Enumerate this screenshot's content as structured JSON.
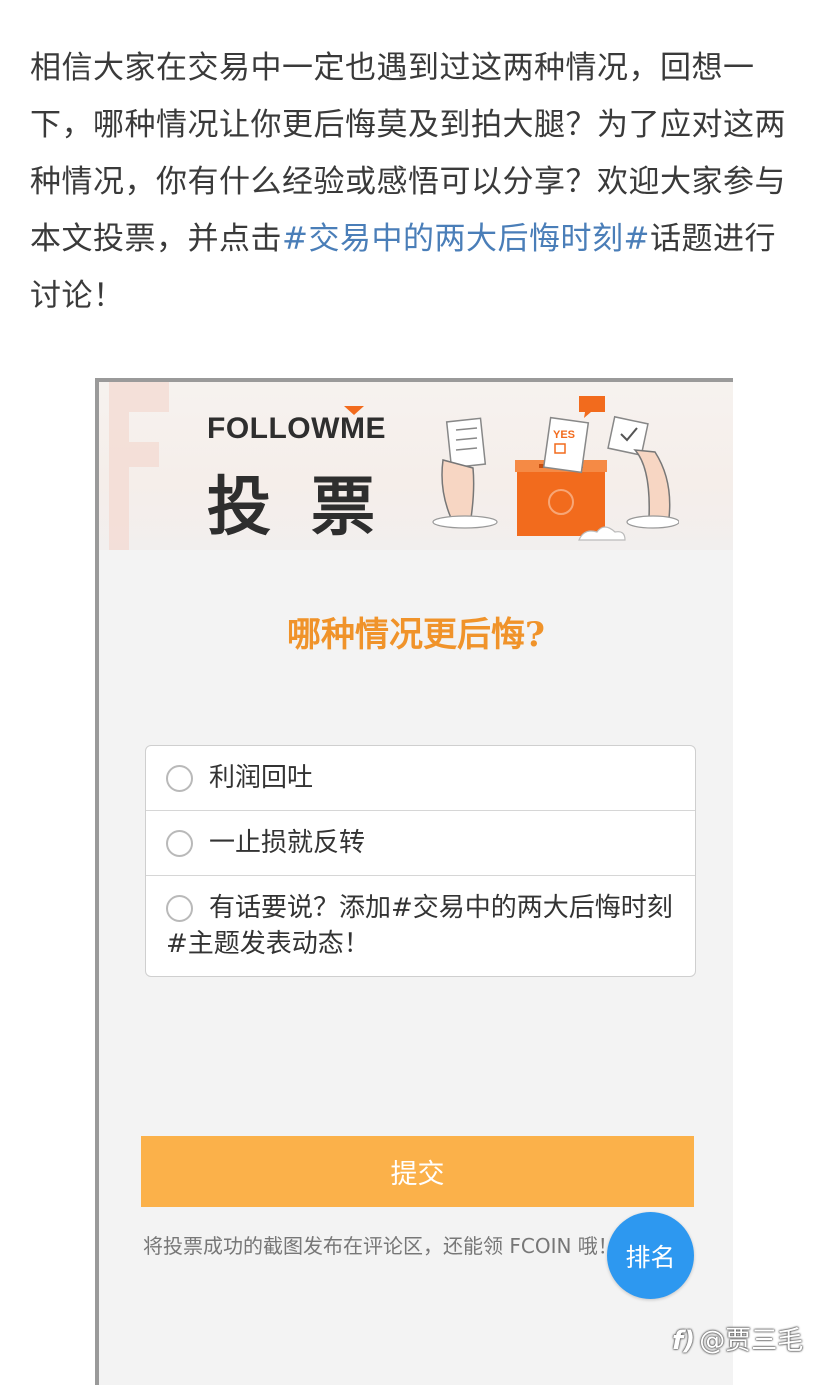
{
  "intro": {
    "text_before": "相信大家在交易中一定也遇到过这两种情况，回想一下，哪种情况让你更后悔莫及到拍大腿？为了应对这两种情况，你有什么经验或感悟可以分享？欢迎大家参与本文投票，并点击",
    "topic_link": "#交易中的两大后悔时刻#",
    "text_after": "话题进行讨论！"
  },
  "banner": {
    "brand_prefix": "FOLLOW",
    "brand_m": "M",
    "brand_suffix": "E",
    "title": "投票",
    "yes_label": "YES"
  },
  "poll": {
    "question": "哪种情况更后悔?",
    "options": [
      "利润回吐",
      "一止损就反转",
      "有话要说？添加#交易中的两大后悔时刻#主题发表动态！"
    ],
    "submit_label": "提交",
    "note": "将投票成功的截图发布在评论区，还能领 FCOIN 哦！",
    "rank_label": "排名"
  },
  "watermark": {
    "logo": "f)",
    "text": "@贾三毛"
  },
  "colors": {
    "accent_orange": "#f0932a",
    "submit_bg": "#fbb14a",
    "rank_bg": "#2d98f0",
    "topic_link": "#4a7eb8"
  }
}
